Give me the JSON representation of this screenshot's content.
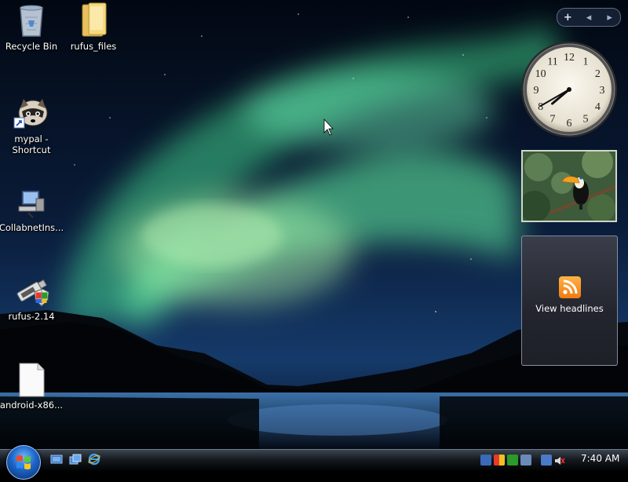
{
  "desktop": {
    "icons": [
      {
        "label": "Recycle Bin",
        "icon": "recycle-bin-icon"
      },
      {
        "label": "rufus_files",
        "icon": "folder-icon"
      },
      {
        "label": "mypal - Shortcut",
        "icon": "raccoon-shortcut-icon"
      },
      {
        "label": "CollabnetIns...",
        "icon": "installer-computer-icon"
      },
      {
        "label": "rufus-2.14",
        "icon": "usb-drive-shield-icon"
      },
      {
        "label": "android-x86...",
        "icon": "blank-file-icon"
      }
    ]
  },
  "sidebar": {
    "toolbar": {
      "add": "+",
      "prev": "◂",
      "next": "▸"
    },
    "clock": {
      "hour": 7,
      "minute": 40,
      "numbers": [
        "12",
        "1",
        "2",
        "3",
        "4",
        "5",
        "6",
        "7",
        "8",
        "9",
        "10",
        "11"
      ]
    },
    "slideshow": {
      "subject": "toucan-photo"
    },
    "feed": {
      "headline_label": "View headlines",
      "icon": "rss-feed-icon"
    }
  },
  "taskbar": {
    "start": {
      "icon": "windows-start-orb"
    },
    "quick_launch": [
      "show-desktop-icon",
      "switch-windows-icon",
      "internet-explorer-icon"
    ],
    "tray_icons": [
      "network-icon",
      "security-shield-icon",
      "windows-update-icon",
      "safely-remove-icon",
      "network-connection-icon",
      "volume-muted-icon"
    ],
    "clock": "7:40 AM"
  },
  "colors": {
    "aurora": "#3fd08a",
    "sky": "#0a1a30",
    "taskbar": "#15191f"
  }
}
